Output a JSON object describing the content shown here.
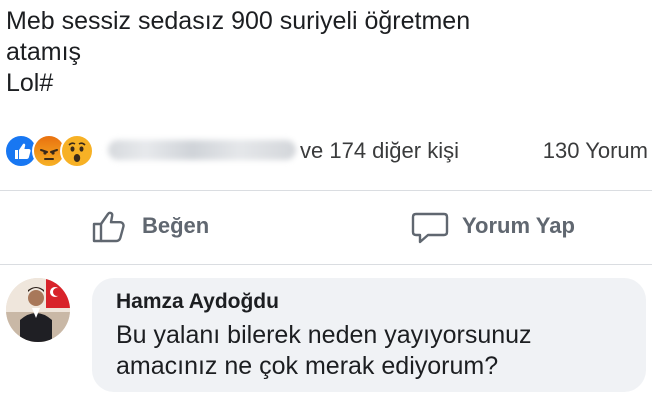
{
  "post": {
    "lines": [
      "Meb sessiz sedasız 900 suriyeli öğretmen",
      "atamış",
      "Lol#"
    ]
  },
  "reactions": {
    "icons": [
      "like-icon",
      "angry-icon",
      "wow-icon"
    ],
    "summary": "ve 174 diğer kişi",
    "comments_count": "130 Yorum"
  },
  "actions": {
    "like_label": "Beğen",
    "comment_label": "Yorum Yap"
  },
  "comment": {
    "author": "Hamza Aydoğdu",
    "lines": [
      "Bu yalanı bilerek neden yayıyorsunuz",
      "amacınız ne çok merak ediyorum?"
    ]
  },
  "colors": {
    "like_blue": "#1877f2",
    "bubble_bg": "#f0f2f5",
    "action_grey": "#606770"
  }
}
